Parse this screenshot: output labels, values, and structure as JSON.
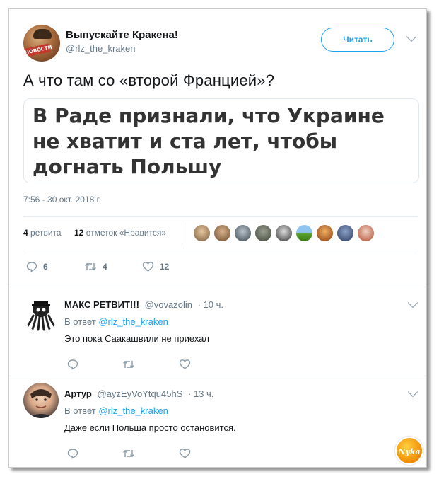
{
  "tweet": {
    "author_name": "Выпускайте Кракена!",
    "author_handle": "@rlz_the_kraken",
    "avatar_badge": "НОВОСТИ",
    "follow_label": "Читать",
    "text": "А что там со «второй Францией»?",
    "card_text": "В Раде признали, что Украине не хватит и ста лет, чтобы догнать Польшу",
    "timestamp": "7:56 - 30 окт. 2018 г.",
    "retweets_count": "4",
    "retweets_label": "ретвита",
    "likes_count": "12",
    "likes_label": "отметок «Нравится»",
    "actions": {
      "reply_count": "6",
      "retweet_count": "4",
      "like_count": "12"
    }
  },
  "replies": [
    {
      "name": "МАКС РЕТВИТ!!!",
      "handle": "@vovazolin",
      "time": "· 10 ч.",
      "reply_to_prefix": "В ответ",
      "reply_to_mention": "@rlz_the_kraken",
      "text": "Это пока Саакашвили не приехал"
    },
    {
      "name": "Артур",
      "handle": "@ayzEyVoYtqu45hS",
      "time": "· 13 ч.",
      "reply_to_prefix": "В ответ",
      "reply_to_mention": "@rlz_the_kraken",
      "text": "Даже если Польша просто остановится."
    }
  ],
  "watermark": "Nyka",
  "colors": {
    "accent": "#1da1f2",
    "muted": "#657786",
    "icon": "#8899a6",
    "text": "#14171a"
  }
}
